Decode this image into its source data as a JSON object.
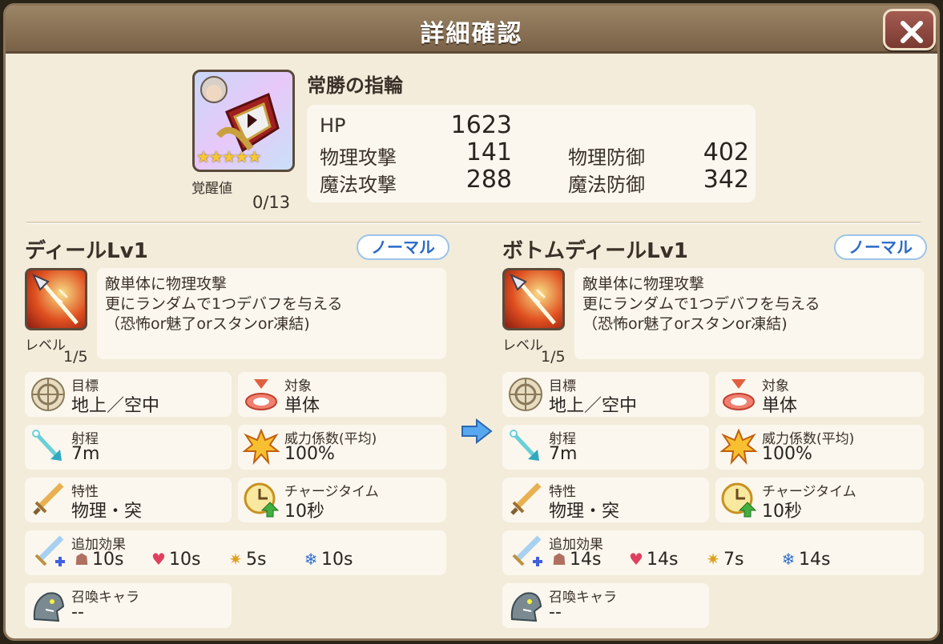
{
  "title": "詳細確認",
  "close_icon": "close-x-icon",
  "item": {
    "name": "常勝の指輪",
    "stars": "★★★★★",
    "awaken_label": "覚醒値",
    "awaken_value": "0/13",
    "stats": {
      "hp_label": "HP",
      "hp": "1623",
      "patk_label": "物理攻撃",
      "patk": "141",
      "matk_label": "魔法攻撃",
      "matk": "288",
      "pdef_label": "物理防御",
      "pdef": "402",
      "mdef_label": "魔法防御",
      "mdef": "342"
    }
  },
  "left": {
    "skill_name": "ディールLv1",
    "badge": "ノーマル",
    "level_label": "レベル",
    "level_value": "1/5",
    "desc": [
      "敵単体に物理攻撃",
      "更にランダムで1つデバフを与える",
      "（恐怖or魅了orスタンor凍結)"
    ],
    "target_label": "目標",
    "target": "地上／空中",
    "object_label": "対象",
    "object": "単体",
    "range_label": "射程",
    "range": "7m",
    "power_label": "威力係数(平均)",
    "power": "100%",
    "trait_label": "特性",
    "trait": "物理・突",
    "charge_label": "チャージタイム",
    "charge": "10秒",
    "effect_label": "追加効果",
    "effects": {
      "fear": "10s",
      "charm": "10s",
      "stun": "5s",
      "freeze": "10s"
    },
    "summon_label": "召喚キャラ",
    "summon": "--"
  },
  "right": {
    "skill_name": "ボトムディールLv1",
    "badge": "ノーマル",
    "level_label": "レベル",
    "level_value": "1/5",
    "desc": [
      "敵単体に物理攻撃",
      "更にランダムで1つデバフを与える",
      "（恐怖or魅了orスタンor凍結)"
    ],
    "target_label": "目標",
    "target": "地上／空中",
    "object_label": "対象",
    "object": "単体",
    "range_label": "射程",
    "range": "7m",
    "power_label": "威力係数(平均)",
    "power": "100%",
    "trait_label": "特性",
    "trait": "物理・突",
    "charge_label": "チャージタイム",
    "charge": "10秒",
    "effect_label": "追加効果",
    "effects": {
      "fear": "14s",
      "charm": "14s",
      "stun": "7s",
      "freeze": "14s"
    },
    "summon_label": "召喚キャラ",
    "summon": "--"
  },
  "colors": {
    "accent": "#2a6ac8",
    "frame": "#8a7458",
    "panel": "#fbf7ee"
  }
}
